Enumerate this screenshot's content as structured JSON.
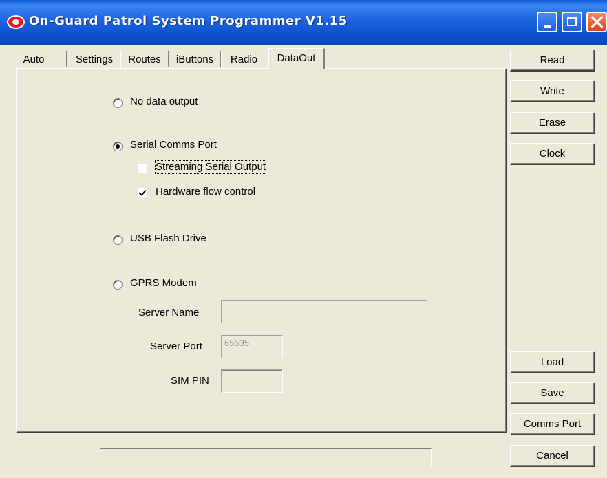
{
  "window": {
    "title": "On-Guard Patrol System Programmer V1.15",
    "accent_color": "#0a5bd6",
    "icon": "on-guard-app-icon"
  },
  "tabs": [
    {
      "label": "Auto"
    },
    {
      "label": "Settings"
    },
    {
      "label": "Routes"
    },
    {
      "label": "iButtons"
    },
    {
      "label": "Radio"
    },
    {
      "label": "DataOut",
      "active": true
    }
  ],
  "dataout": {
    "no_output": {
      "label": "No data output",
      "selected": false
    },
    "serial": {
      "label": "Serial Comms Port",
      "selected": true,
      "streaming": {
        "label": "Streaming Serial Output",
        "checked": false
      },
      "flow_control": {
        "label": "Hardware flow control",
        "checked": true
      }
    },
    "usb": {
      "label": "USB Flash Drive",
      "selected": false
    },
    "gprs": {
      "label": "GPRS Modem",
      "selected": false,
      "server_name": {
        "label": "Server Name",
        "value": ""
      },
      "server_port": {
        "label": "Server Port",
        "value": "65535"
      },
      "sim_pin": {
        "label": "SIM PIN",
        "value": ""
      }
    }
  },
  "buttons": {
    "read": "Read",
    "write": "Write",
    "erase": "Erase",
    "clock": "Clock",
    "load": "Load",
    "save": "Save",
    "comms_port": "Comms Port",
    "cancel": "Cancel"
  },
  "status": {
    "text": ""
  }
}
